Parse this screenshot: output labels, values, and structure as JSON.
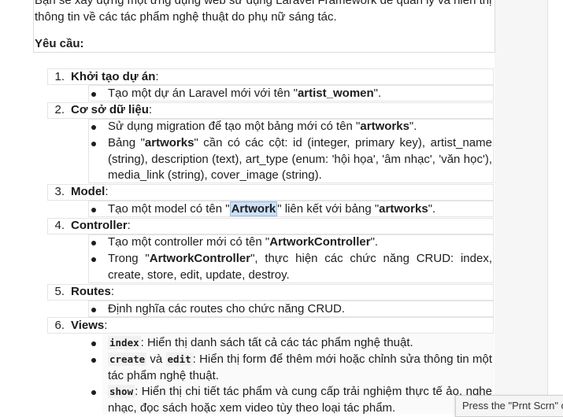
{
  "intro": {
    "line1": "Bạn sẽ xây dựng một ứng dụng web sử dụng Laravel Framework để quản lý và hiển thị",
    "line2": "thông tin về các tác phẩm nghệ thuật do phụ nữ sáng tác."
  },
  "requirements_label": "Yêu cầu:",
  "items": [
    {
      "num": "1.",
      "title": "Khởi tạo dự án",
      "bullets": [
        {
          "pre": "Tạo một dự án Laravel mới với tên \"",
          "bold": "artist_women",
          "post": "\"."
        }
      ]
    },
    {
      "num": "2.",
      "title": "Cơ sở dữ liệu",
      "bullets": [
        {
          "pre": "Sử dụng migration để tạo một bảng mới có tên \"",
          "bold": "artworks",
          "post": "\"."
        },
        {
          "pre": "Bảng \"",
          "bold": "artworks",
          "post": "\" cần có các cột: id (integer, primary key), artist_name (string), description (text), art_type (enum: 'hội họa', 'âm nhạc', 'văn học'), media_link (string), cover_image (string)."
        }
      ]
    },
    {
      "num": "3.",
      "title": "Model",
      "bullets": [
        {
          "pre": "Tạo một model có tên \"",
          "bold": "Artwork",
          "mid": "\" liên kết với bảng \"",
          "bold2": "artworks",
          "post": "\"."
        }
      ]
    },
    {
      "num": "4.",
      "title": "Controller",
      "bullets": [
        {
          "pre": "Tạo một controller mới có tên \"",
          "bold": "ArtworkController",
          "post": "\"."
        },
        {
          "pre": "Trong \"",
          "bold": "ArtworkController",
          "post": "\", thực hiện các chức năng CRUD: index, create, store, edit, update, destroy."
        }
      ]
    },
    {
      "num": "5.",
      "title": "Routes",
      "bullets": [
        {
          "pre": "Định nghĩa các routes cho chức năng CRUD."
        }
      ]
    },
    {
      "num": "6.",
      "title": "Views",
      "bullets": [
        {
          "code": "index",
          "post": ": Hiển thị danh sách tất cả các tác phẩm nghệ thuật."
        },
        {
          "code": "create",
          "mid": " và ",
          "code2": "edit",
          "post": ": Hiển thị form để thêm mới hoặc chỉnh sửa thông tin một tác phẩm nghệ thuật."
        },
        {
          "code": "show",
          "post": ": Hiển thị chi tiết tác phẩm và cung cấp trải nghiệm thực tế ảo, nghe nhạc, đọc sách hoặc xem video tùy theo loại tác phẩm."
        }
      ]
    }
  ],
  "tooltip": "Press the \"Prnt Scrn\" c"
}
